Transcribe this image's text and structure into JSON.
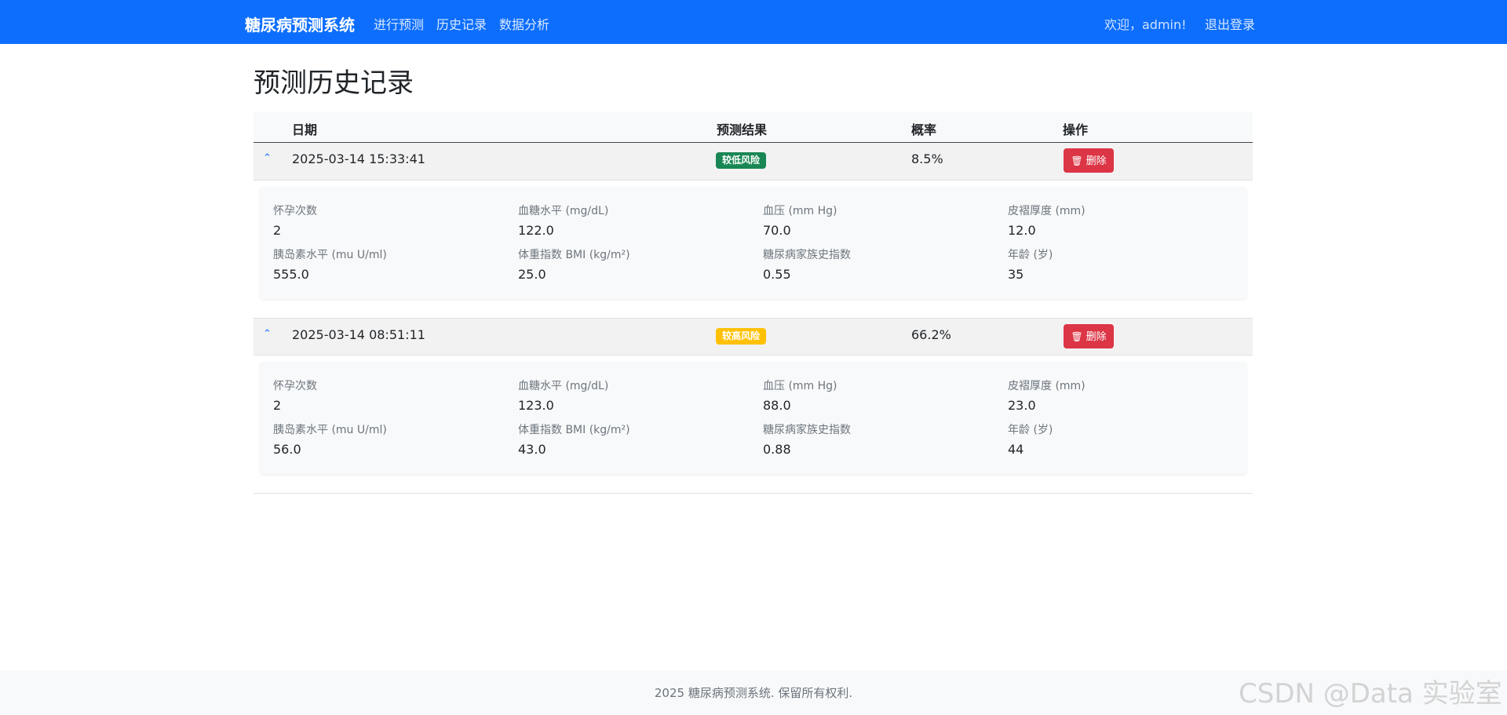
{
  "nav": {
    "brand": "糖尿病预测系统",
    "links": [
      "进行预测",
      "历史记录",
      "数据分析"
    ],
    "welcome": "欢迎，admin!",
    "logout": "退出登录"
  },
  "page": {
    "title": "预测历史记录"
  },
  "table": {
    "headers": {
      "date": "日期",
      "result": "预测结果",
      "probability": "概率",
      "action": "操作"
    },
    "rows": [
      {
        "date": "2025-03-14 15:33:41",
        "result": "较低风险",
        "result_color": "#198754",
        "probability": "8.5%",
        "delete_label": "删除",
        "details": [
          {
            "label": "怀孕次数",
            "value": "2"
          },
          {
            "label": "血糖水平 (mg/dL)",
            "value": "122.0"
          },
          {
            "label": "血压 (mm Hg)",
            "value": "70.0"
          },
          {
            "label": "皮褶厚度 (mm)",
            "value": "12.0"
          },
          {
            "label": "胰岛素水平 (mu U/ml)",
            "value": "555.0"
          },
          {
            "label": "体重指数 BMI (kg/m²)",
            "value": "25.0"
          },
          {
            "label": "糖尿病家族史指数",
            "value": "0.55"
          },
          {
            "label": "年龄 (岁)",
            "value": "35"
          }
        ]
      },
      {
        "date": "2025-03-14 08:51:11",
        "result": "较高风险",
        "result_color": "#ffc107",
        "probability": "66.2%",
        "delete_label": "删除",
        "details": [
          {
            "label": "怀孕次数",
            "value": "2"
          },
          {
            "label": "血糖水平 (mg/dL)",
            "value": "123.0"
          },
          {
            "label": "血压 (mm Hg)",
            "value": "88.0"
          },
          {
            "label": "皮褶厚度 (mm)",
            "value": "23.0"
          },
          {
            "label": "胰岛素水平 (mu U/ml)",
            "value": "56.0"
          },
          {
            "label": "体重指数 BMI (kg/m²)",
            "value": "43.0"
          },
          {
            "label": "糖尿病家族史指数",
            "value": "0.88"
          },
          {
            "label": "年龄 (岁)",
            "value": "44"
          }
        ]
      }
    ]
  },
  "footer": {
    "text": "2025 糖尿病预测系统. 保留所有权利."
  },
  "watermark": "CSDN @Data 实验室",
  "icons": {
    "expand": "chevron-up-icon",
    "delete": "trash-icon"
  },
  "colors": {
    "primary": "#0d6efd",
    "danger": "#dc3545",
    "success": "#198754",
    "warning": "#ffc107"
  }
}
